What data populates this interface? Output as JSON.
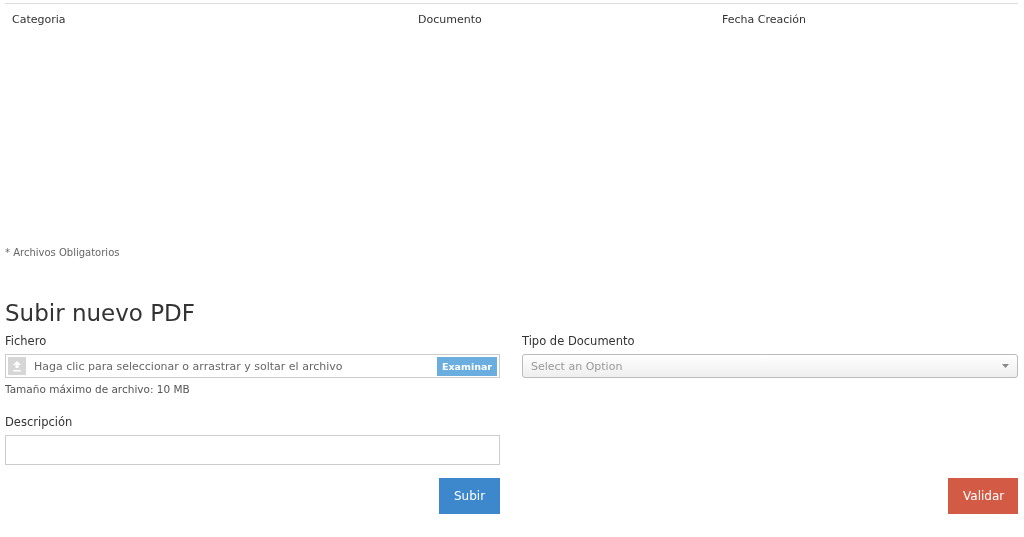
{
  "table": {
    "columns": [
      "Categoria",
      "Documento",
      "Fecha Creación"
    ]
  },
  "required_note": "* Archivos Obligatorios",
  "upload": {
    "title": "Subir nuevo PDF",
    "file_label": "Fichero",
    "file_placeholder": "Haga clic para seleccionar o arrastrar y soltar el archivo",
    "browse_button": "Examinar",
    "size_hint": "Tamaño máximo de archivo: 10 MB",
    "description_label": "Descripción",
    "type_label": "Tipo de Documento",
    "type_placeholder": "Select an Option",
    "upload_button": "Subir",
    "validate_button": "Validar"
  }
}
